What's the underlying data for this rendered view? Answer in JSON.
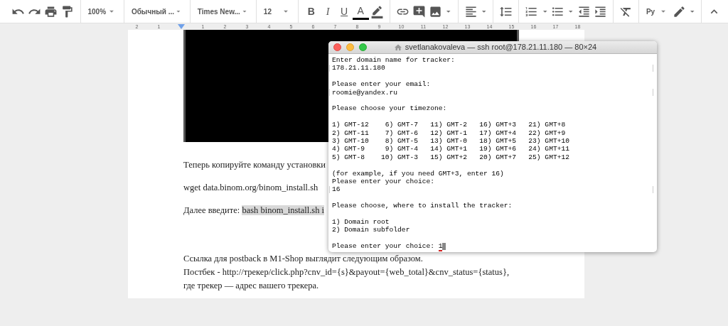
{
  "toolbar": {
    "zoom": "100%",
    "style": "Обычный ...",
    "font": "Times New...",
    "font_size": "12",
    "bold": "B",
    "italic": "I",
    "underline": "U",
    "text_color": "A",
    "input_tools": "Ру"
  },
  "ruler": {
    "labels": [
      "2",
      "1",
      "1",
      "2",
      "3",
      "4",
      "5",
      "6",
      "7",
      "8",
      "9",
      "10",
      "11",
      "12",
      "13",
      "14",
      "15",
      "16",
      "17",
      "18"
    ]
  },
  "document": {
    "paragraphs": [
      {
        "kind": "text",
        "parts": [
          {
            "text": "Теперь копируйте команду установки",
            "highlighted": false
          }
        ]
      },
      {
        "kind": "text",
        "parts": [
          {
            "text": "wget data.binom.org/binom_install.sh",
            "highlighted": false
          }
        ]
      },
      {
        "kind": "text",
        "parts": [
          {
            "text": "Далее введите: ",
            "highlighted": false
          },
          {
            "text": "bash binom_install.sh i",
            "highlighted": true
          }
        ]
      },
      {
        "kind": "lines",
        "lines": [
          "Ссылка для postback в M1-Shop выглядит следующим образом.",
          "Постбек - http://трекер/click.php?cnv_id={s}&payout={web_total}&cnv_status={status},",
          "где трекер — адрес вашего трекера."
        ]
      }
    ]
  },
  "terminal": {
    "title": "svetlanakovaleva — ssh root@178.21.11.180 — 80×24",
    "lines": [
      {
        "kind": "output",
        "text": "Enter domain name for tracker:"
      },
      {
        "kind": "input",
        "text": "178.21.11.180"
      },
      {
        "kind": "blank"
      },
      {
        "kind": "output",
        "text": "Please enter your email:"
      },
      {
        "kind": "input",
        "text": "roomie@yandex.ru"
      },
      {
        "kind": "blank"
      },
      {
        "kind": "output",
        "text": "Please choose your timezone:"
      },
      {
        "kind": "blank"
      },
      {
        "kind": "output",
        "text": "1) GMT-12    6) GMT-7   11) GMT-2   16) GMT+3   21) GMT+8"
      },
      {
        "kind": "output",
        "text": "2) GMT-11    7) GMT-6   12) GMT-1   17) GMT+4   22) GMT+9"
      },
      {
        "kind": "output",
        "text": "3) GMT-10    8) GMT-5   13) GMT-0   18) GMT+5   23) GMT+10"
      },
      {
        "kind": "output",
        "text": "4) GMT-9     9) GMT-4   14) GMT+1   19) GMT+6   24) GMT+11"
      },
      {
        "kind": "output",
        "text": "5) GMT-8    10) GMT-3   15) GMT+2   20) GMT+7   25) GMT+12"
      },
      {
        "kind": "blank"
      },
      {
        "kind": "output",
        "text": "(for example, if you need GMT+3, enter 16)"
      },
      {
        "kind": "output",
        "text": "Please enter your choice:"
      },
      {
        "kind": "input",
        "text": "16"
      },
      {
        "kind": "blank"
      },
      {
        "kind": "output",
        "text": "Please choose, where to install the tracker:"
      },
      {
        "kind": "blank"
      },
      {
        "kind": "output",
        "text": "1) Domain root"
      },
      {
        "kind": "output",
        "text": "2) Domain subfolder"
      },
      {
        "kind": "blank"
      },
      {
        "kind": "prompt",
        "text": "Please enter your choice: ",
        "value": "1"
      }
    ]
  }
}
